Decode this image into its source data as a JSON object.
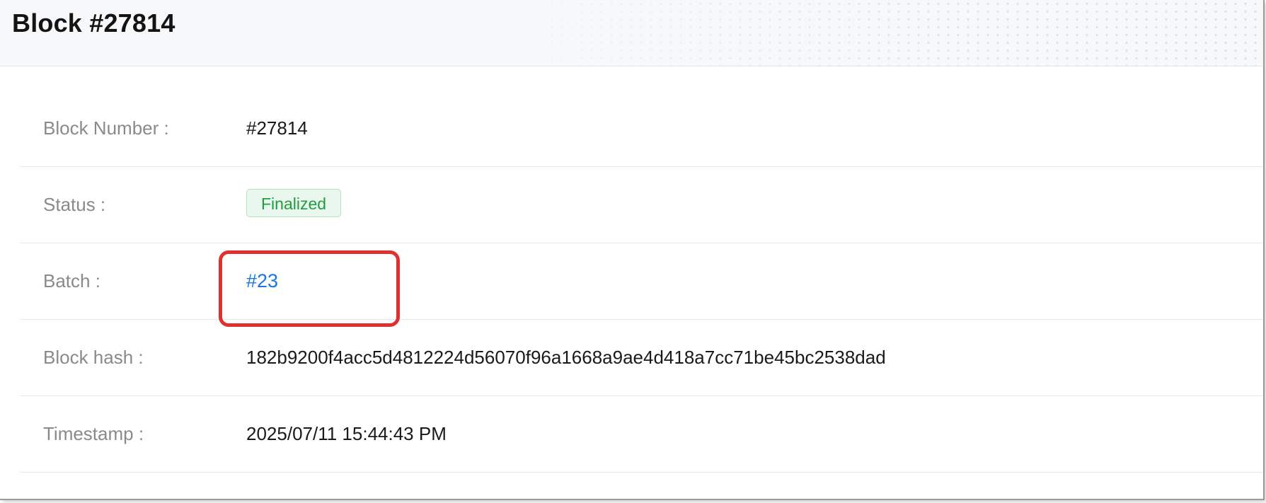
{
  "header": {
    "title": "Block #27814"
  },
  "details": {
    "block_number": {
      "label": "Block Number :",
      "value": "#27814"
    },
    "status": {
      "label": "Status :",
      "value": "Finalized",
      "color": "#1f9d3f"
    },
    "batch": {
      "label": "Batch :",
      "value": "#23",
      "link_color": "#1976e8"
    },
    "block_hash": {
      "label": "Block hash :",
      "value": "182b9200f4acc5d4812224d56070f96a1668a9ae4d418a7cc71be45bc2538dad"
    },
    "timestamp": {
      "label": "Timestamp :",
      "value": "2025/07/11 15:44:43 PM"
    }
  },
  "annotation": {
    "highlight_color": "#e03030"
  }
}
